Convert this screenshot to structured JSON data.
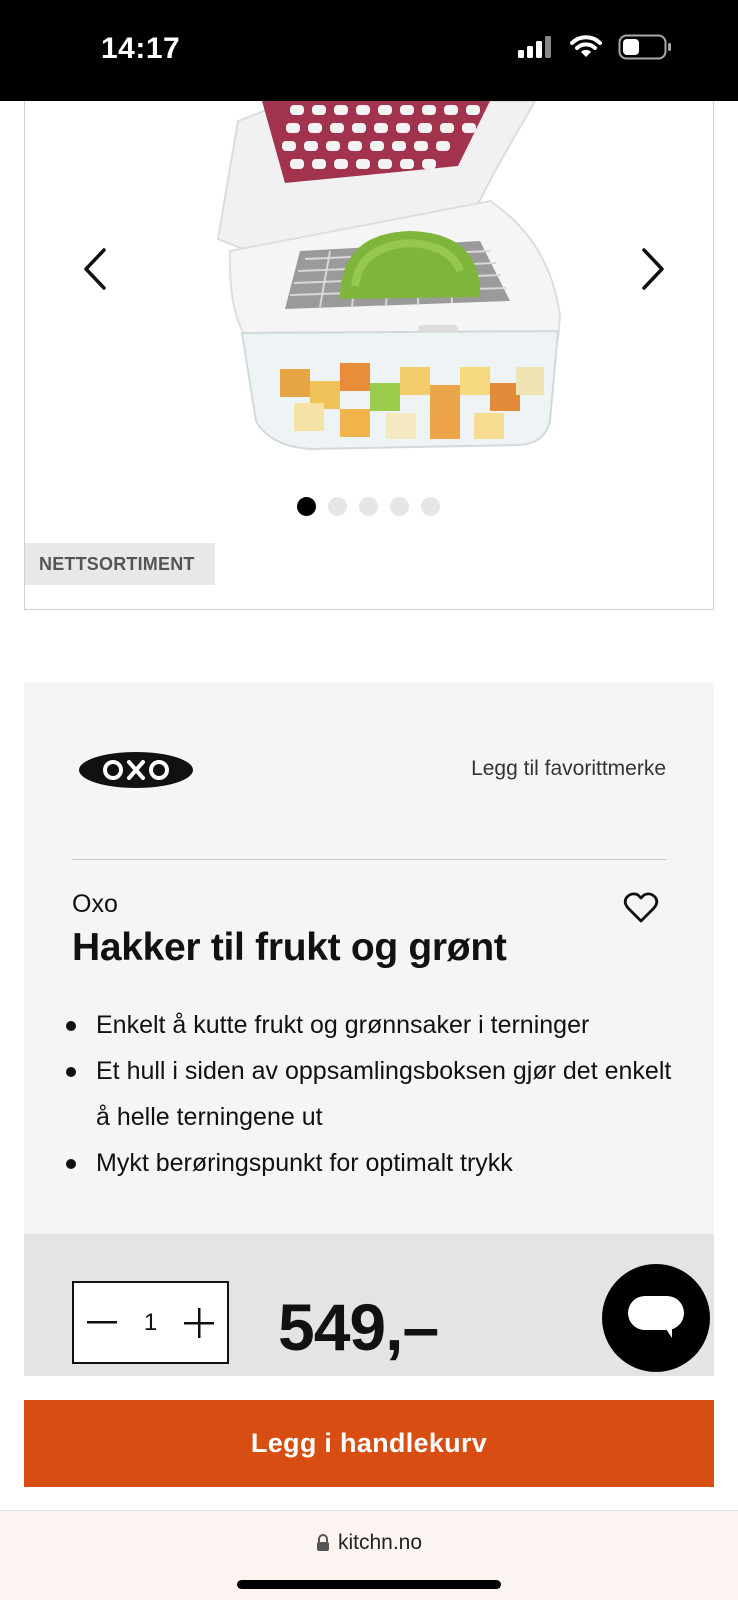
{
  "status_bar": {
    "time": "14:17",
    "icons": [
      "signal-icon",
      "wifi-icon",
      "battery-icon"
    ]
  },
  "gallery": {
    "badge": "NETTSORTIMENT",
    "image_description_icon": "product-photo-icon",
    "dots_total": 5,
    "active_dot": 1
  },
  "brand": {
    "logo_text": "OXO",
    "favorite_brand_label": "Legg til favorittmerke"
  },
  "product": {
    "brand_name": "Oxo",
    "title": "Hakker til frukt og grønt",
    "features": [
      "Enkelt å kutte frukt og grønnsaker i terninger",
      "Et hull i siden av oppsamlingsboksen gjør det enkelt å helle terningene ut",
      "Mykt berøringspunkt for optimalt trykk"
    ],
    "quantity": "1",
    "price": "549,–"
  },
  "cart": {
    "add_label": "Legg i handlekurv"
  },
  "browser": {
    "url": "kitchn.no"
  },
  "colors": {
    "accent": "#d84e12",
    "panel_bg": "#f6f5f5",
    "price_row_bg": "#e4e4e4"
  }
}
